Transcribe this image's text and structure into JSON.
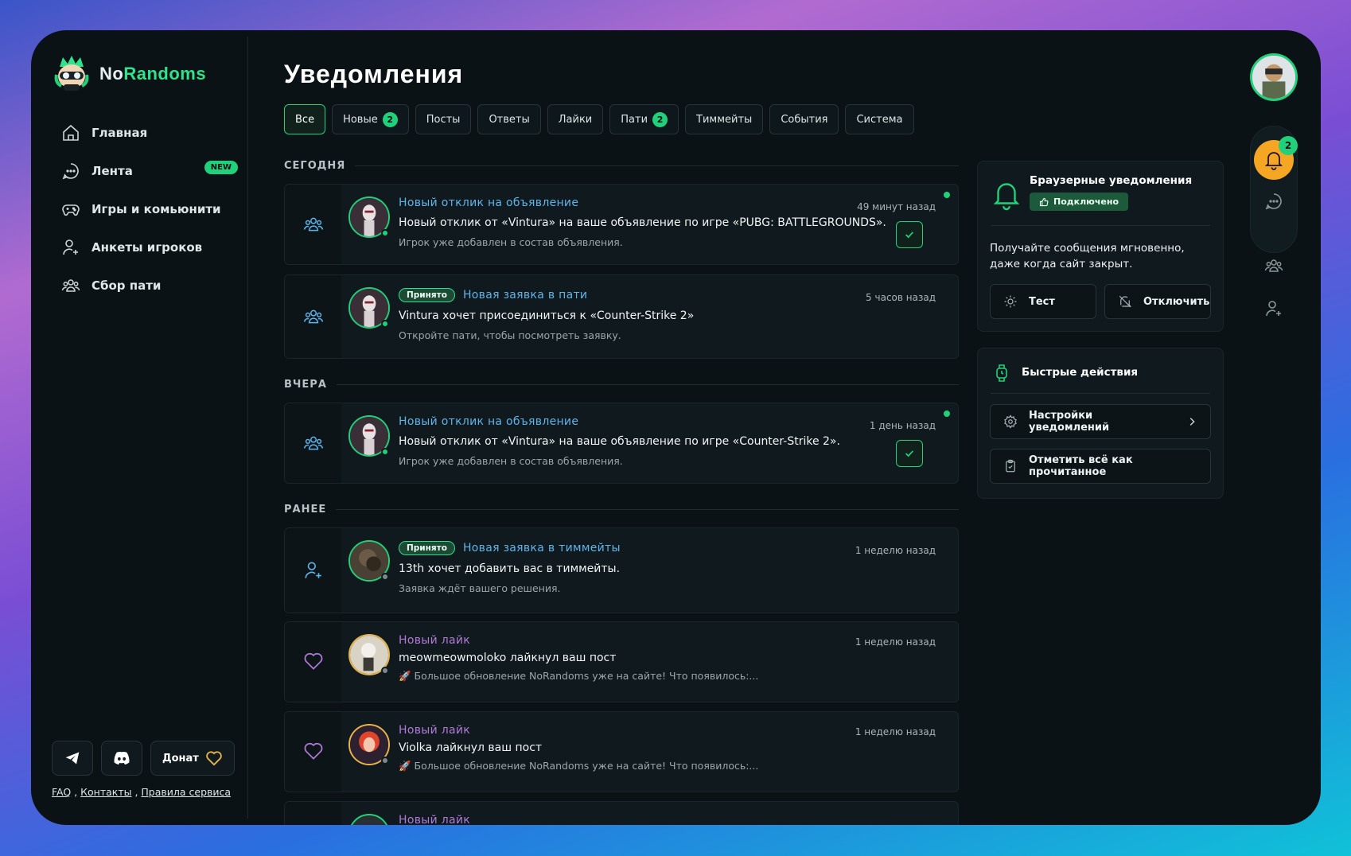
{
  "brand": {
    "name_part1": "No",
    "name_part2": "Randoms"
  },
  "nav": [
    {
      "label": "Главная",
      "icon": "home-icon"
    },
    {
      "label": "Лента",
      "icon": "chat-icon",
      "badge": "NEW"
    },
    {
      "label": "Игры и комьюнити",
      "icon": "gamepad-icon"
    },
    {
      "label": "Анкеты игроков",
      "icon": "user-add-icon"
    },
    {
      "label": "Сбор пати",
      "icon": "group-icon"
    }
  ],
  "footer": {
    "donate": "Донат",
    "links": [
      "FAQ",
      "Контакты",
      "Правила сервиса"
    ]
  },
  "page_title": "Уведомления",
  "tabs": [
    {
      "label": "Все",
      "active": true
    },
    {
      "label": "Новые",
      "count": "2"
    },
    {
      "label": "Посты"
    },
    {
      "label": "Ответы"
    },
    {
      "label": "Лайки"
    },
    {
      "label": "Пати",
      "count": "2"
    },
    {
      "label": "Тиммейты"
    },
    {
      "label": "События"
    },
    {
      "label": "Система"
    }
  ],
  "sections": {
    "today": "СЕГОДНЯ",
    "yesterday": "ВЧЕРА",
    "earlier": "РАНЕЕ"
  },
  "notifications": [
    {
      "title": "Новый отклик на объявление",
      "time": "49 минут назад",
      "text": "Новый отклик от «Vintura» на ваше объявление по игре «PUBG: BATTLEGROUNDS».",
      "sub": "Игрок уже добавлен в состав объявления."
    },
    {
      "pill": "Принято",
      "title": "Новая заявка в пати",
      "time": "5 часов назад",
      "text": "Vintura хочет присоединиться к «Counter-Strike 2»",
      "sub": "Откройте пати, чтобы посмотреть заявку."
    },
    {
      "title": "Новый отклик на объявление",
      "time": "1 день назад",
      "text": "Новый отклик от «Vintura» на ваше объявление по игре «Counter-Strike 2».",
      "sub": "Игрок уже добавлен в состав объявления."
    },
    {
      "pill": "Принято",
      "title": "Новая заявка в тиммейты",
      "time": "1 неделю назад",
      "text": "13th хочет добавить вас в тиммейты.",
      "sub": "Заявка ждёт вашего решения."
    },
    {
      "title": "Новый лайк",
      "time": "1 неделю назад",
      "text": "meowmeowmoloko лайкнул ваш пост",
      "sub": "🚀 Большое обновление NoRandoms уже на сайте! Что появилось:..."
    },
    {
      "title": "Новый лайк",
      "time": "1 неделю назад",
      "text": "Violka лайкнул ваш пост",
      "sub": "🚀 Большое обновление NoRandoms уже на сайте! Что появилось:..."
    },
    {
      "title": "Новый лайк"
    }
  ],
  "browser_panel": {
    "title": "Браузерные уведомления",
    "status": "Подключено",
    "desc": "Получайте сообщения мгновенно, даже когда сайт закрыт.",
    "test": "Тест",
    "disable": "Отключить"
  },
  "quick_panel": {
    "title": "Быстрые действия",
    "settings": "Настройки уведомлений",
    "mark_read": "Отметить всё как прочитанное"
  },
  "rail": {
    "notif_count": "2"
  },
  "colors": {
    "accent": "#21d07a",
    "link": "#5fb5ea",
    "like": "#b07ad8",
    "bell": "#f5a623"
  }
}
